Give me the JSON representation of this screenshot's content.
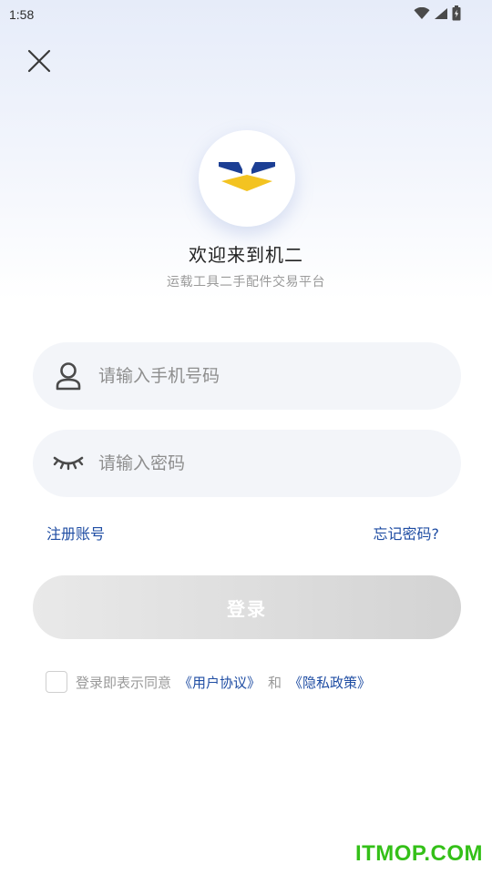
{
  "status_bar": {
    "time": "1:58",
    "icons": [
      "wifi-icon",
      "signal-icon",
      "battery-icon"
    ]
  },
  "header": {
    "close_icon": "close-icon"
  },
  "brand": {
    "logo_icon": "brand-logo-icon",
    "title": "欢迎来到机二",
    "subtitle": "运载工具二手配件交易平台",
    "colors": {
      "blue": "#1c3f94",
      "yellow": "#f3c321"
    }
  },
  "form": {
    "phone": {
      "placeholder": "请输入手机号码",
      "value": "",
      "icon": "user-icon"
    },
    "password": {
      "placeholder": "请输入密码",
      "value": "",
      "icon": "eye-closed-icon"
    }
  },
  "links": {
    "register": "注册账号",
    "forgot": "忘记密码?"
  },
  "login": {
    "label": "登录"
  },
  "agreement": {
    "checked": false,
    "prefix": "登录即表示同意",
    "user_agreement": "《用户协议》",
    "and": "和",
    "privacy_policy": "《隐私政策》"
  },
  "watermark": "ITMOP.COM",
  "theme": {
    "accent": "#1f4da3",
    "field_bg": "#f3f5f9",
    "button_disabled": "#dcdcdc",
    "watermark_color": "#34c018"
  }
}
